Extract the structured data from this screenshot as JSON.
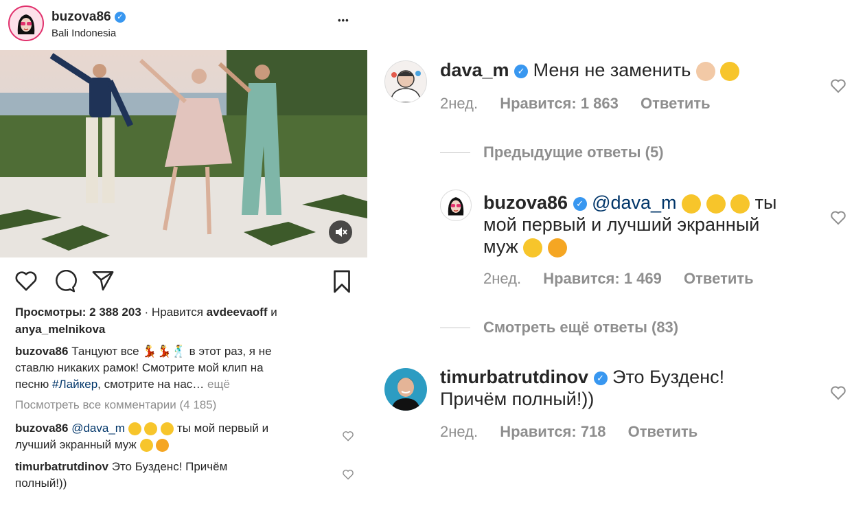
{
  "post": {
    "username": "buzova86",
    "location": "Bali Indonesia",
    "more_label": "•••",
    "views_label": "Просмотры:",
    "views_count": "2 388 203",
    "likes_prefix": "· Нравится",
    "likes_user1": "avdeevaoff",
    "likes_and": "и",
    "likes_user2": "anya_melnikova",
    "caption_user": "buzova86",
    "caption_text_1": "Танцуют все",
    "caption_text_2": "в этот раз, я не",
    "caption_text_3": "ставлю никаких рамок! Смотрите мой клип на",
    "caption_text_4": "песню",
    "caption_hashtag": "#Лайкер",
    "caption_text_5": ", смотрите на нас…",
    "caption_more": "ещё",
    "view_all_comments": "Посмотреть все комментарии (4 185)",
    "comments": [
      {
        "user": "buzova86",
        "mention": "@dava_m",
        "text_a": "ты мой первый и",
        "text_b": "лучший экранный муж"
      },
      {
        "user": "timurbatrutdinov",
        "text_a": "Это Бузденс! Причём",
        "text_b": "полный!))"
      }
    ]
  },
  "thread": {
    "main": {
      "user": "dava_m",
      "text": "Меня не заменить",
      "time": "2нед.",
      "likes": "Нравится: 1 863",
      "reply": "Ответить"
    },
    "prev_replies": "Предыдущие ответы (5)",
    "reply": {
      "user": "buzova86",
      "mention": "@dava_m",
      "text_a": "ты",
      "text_b": "мой первый и лучший экранный",
      "text_c": "муж",
      "time": "2нед.",
      "likes": "Нравится: 1 469",
      "reply": "Ответить"
    },
    "more_replies": "Смотреть ещё ответы (83)",
    "third": {
      "user": "timurbatrutdinov",
      "text_a": "Это Бузденс!",
      "text_b": "Причём полный!))",
      "time": "2нед.",
      "likes": "Нравится: 718",
      "reply": "Ответить"
    }
  },
  "icons": {
    "verified": "verified-badge-icon",
    "heart": "heart-icon",
    "comment": "comment-icon",
    "share": "paper-plane-icon",
    "bookmark": "bookmark-icon",
    "mute": "speaker-muted-icon"
  },
  "colors": {
    "verified": "#3897f0",
    "text": "#262626",
    "secondary": "#8e8e8e",
    "link": "#003569"
  }
}
